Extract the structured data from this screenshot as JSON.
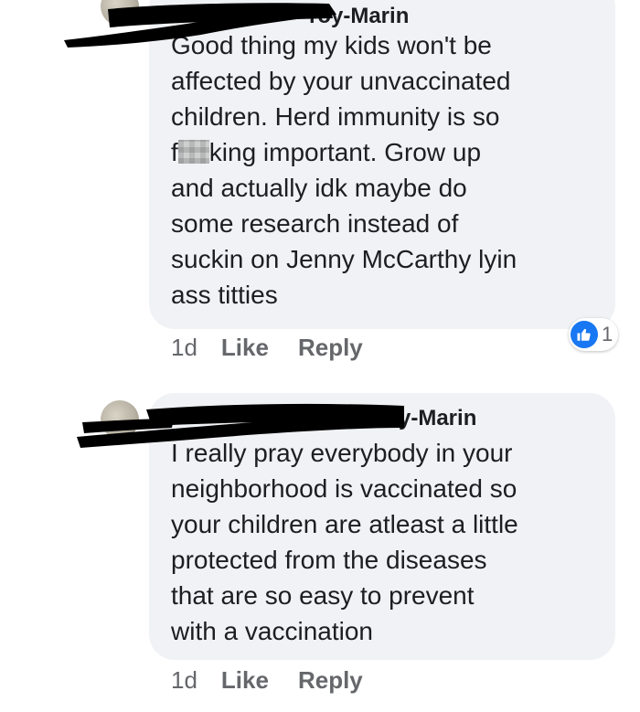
{
  "comments": [
    {
      "author_visible": "roy-Marin",
      "body_before_blur": "Good thing my kids won't be\naffected by your unvaccinated\nchildren. Herd immunity is so\nf",
      "body_after_blur": "king important. Grow up\nand actually idk maybe do\nsome research instead of\nsuckin on Jenny McCarthy lyin\nass titties",
      "time": "1d",
      "like_label": "Like",
      "reply_label": "Reply",
      "reaction_count": "1",
      "reaction_icon": "thumbs-up-icon"
    },
    {
      "author_visible": "y-Marin",
      "body": "I really pray everybody in your\nneighborhood is vaccinated so\nyour children are atleast a little\nprotected from the diseases\nthat are so easy to prevent\nwith a vaccination",
      "time": "1d",
      "like_label": "Like",
      "reply_label": "Reply"
    }
  ],
  "colors": {
    "bubble": "#f0f2f5",
    "text": "#1c1e21",
    "meta": "#65676b",
    "like_badge": "#1877f2"
  }
}
